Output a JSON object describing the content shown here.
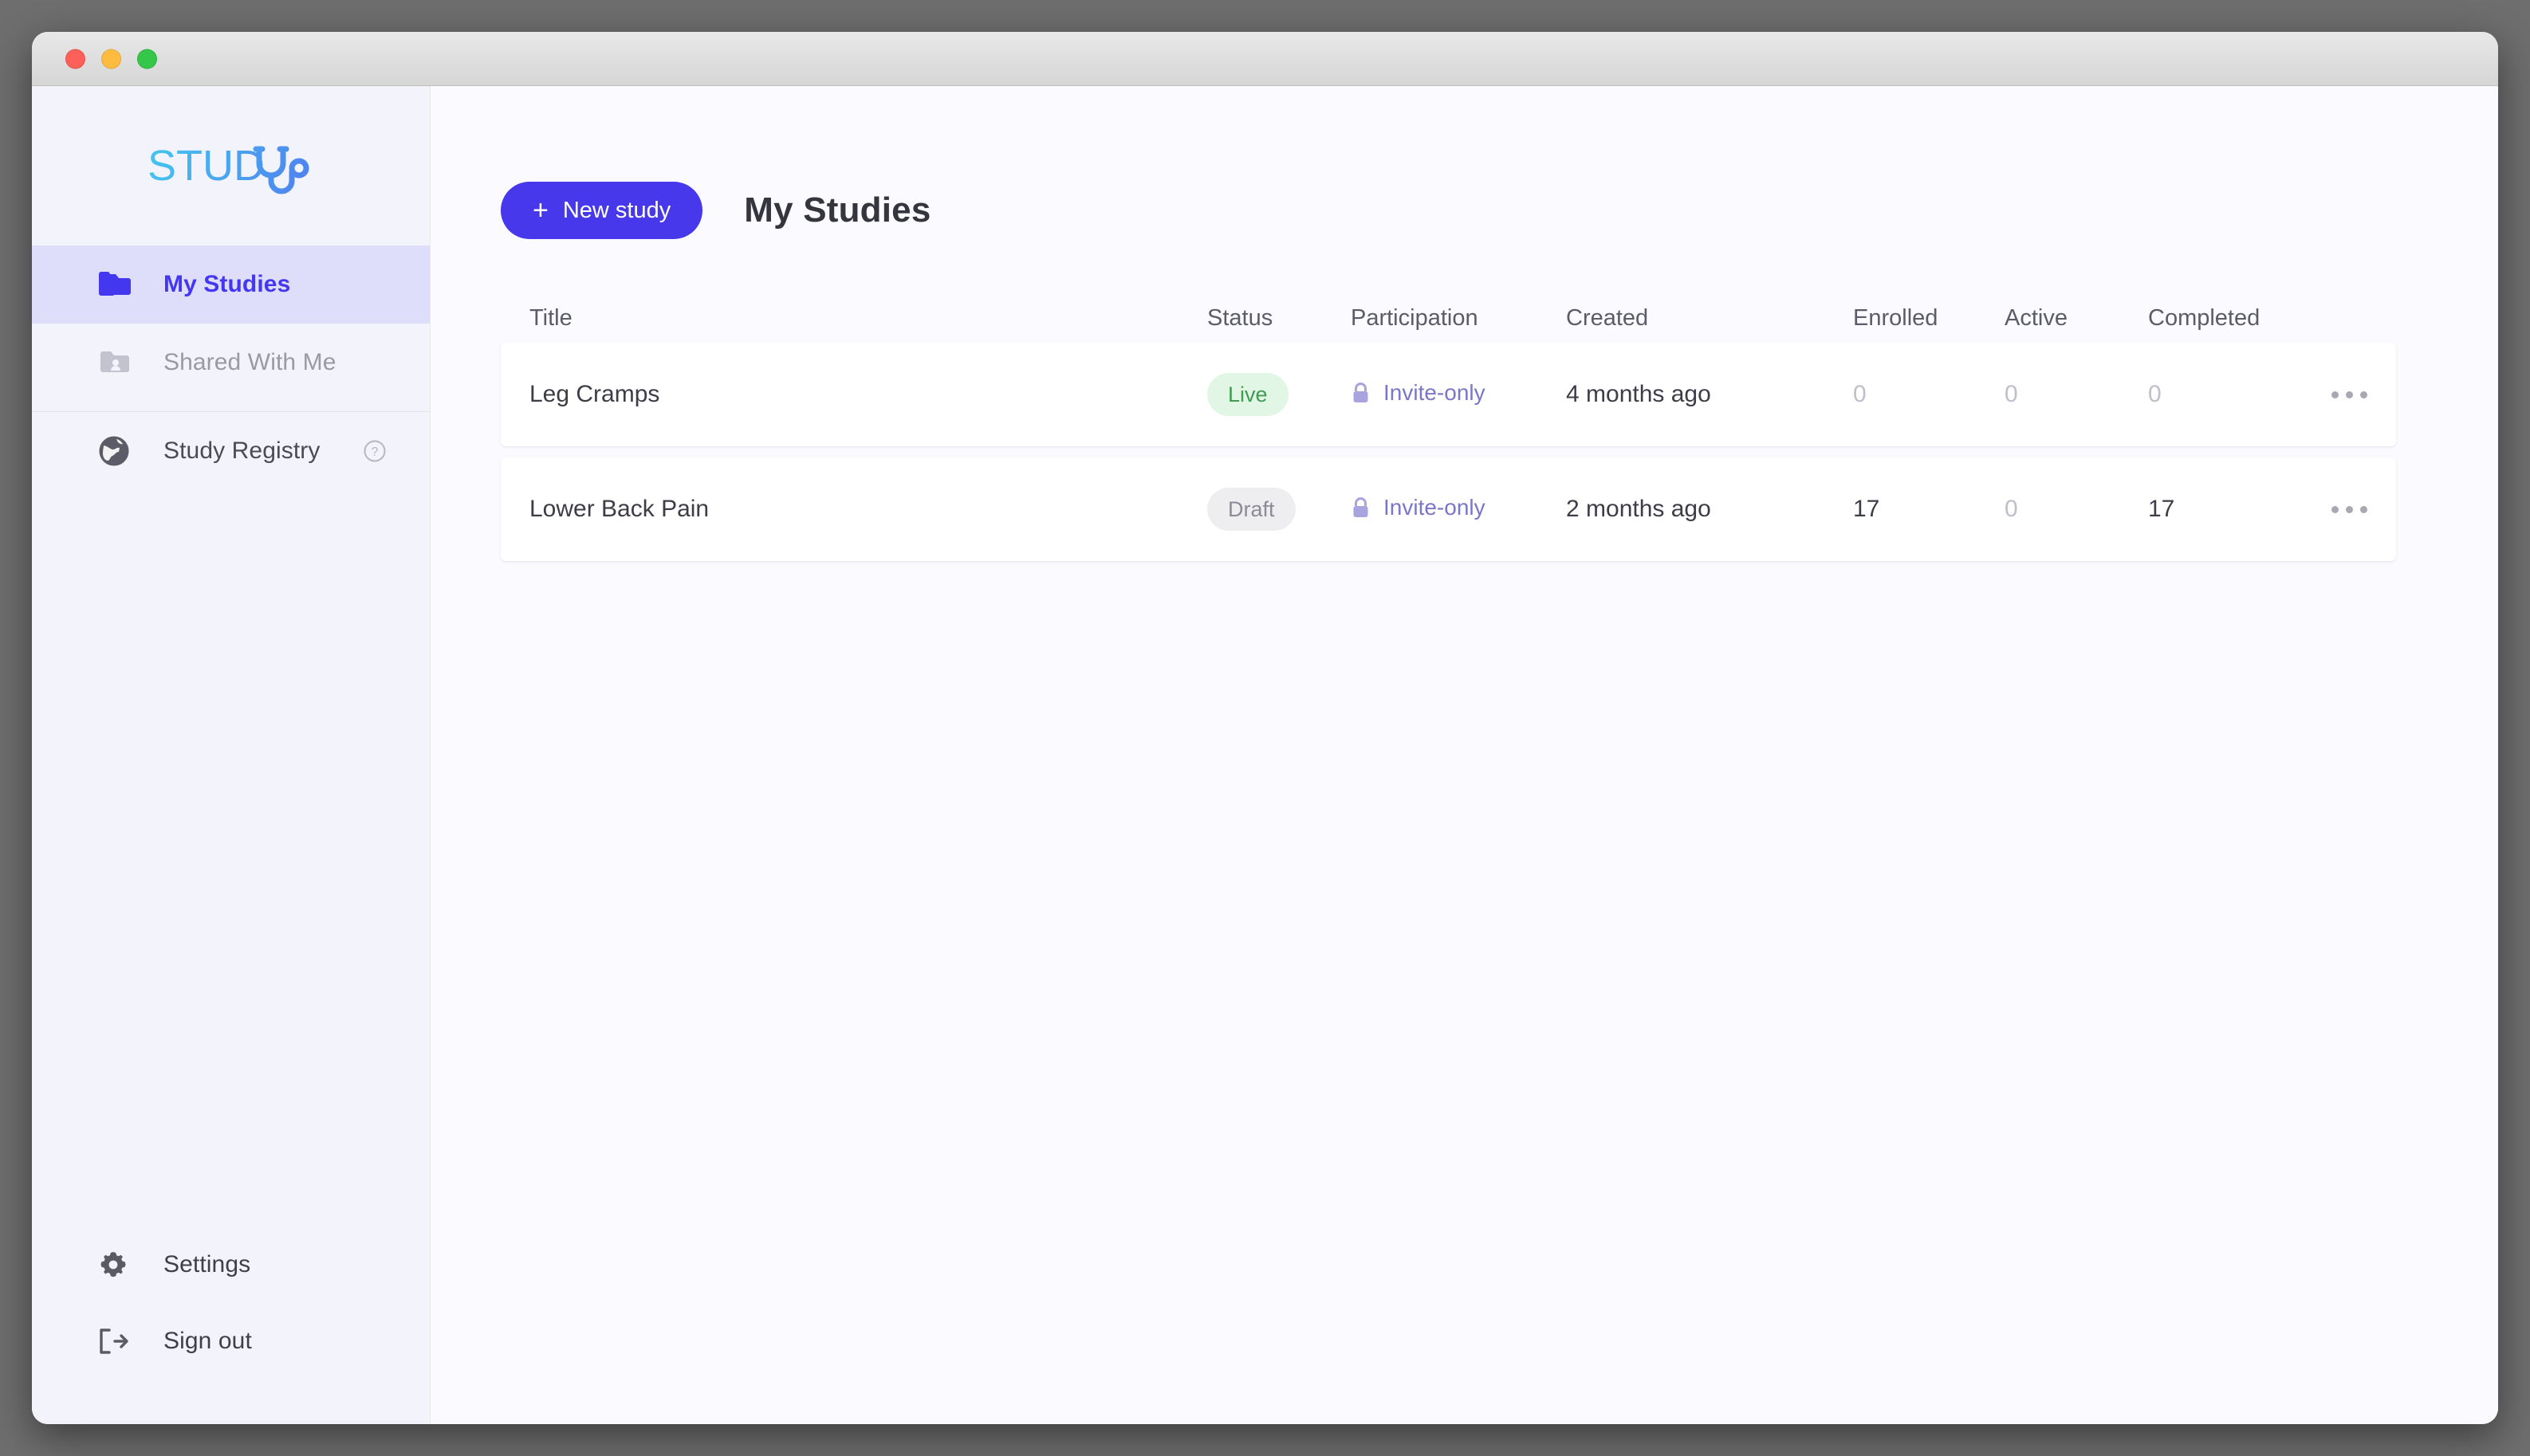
{
  "window": {
    "traffic_lights": [
      "close",
      "minimize",
      "zoom"
    ],
    "colors": {
      "accent": "#4739eb",
      "sidebar_bg": "#f3f3fc",
      "main_bg": "#fafaff",
      "live": "#3f9c52",
      "draft": "#8b8b96",
      "participation": "#7b76c9"
    }
  },
  "sidebar": {
    "logo_text": "STUDY",
    "logo_icon": "stethoscope-icon",
    "primary_items": [
      {
        "label": "My Studies",
        "icon": "folder-copy-icon",
        "active": true
      },
      {
        "label": "Shared With Me",
        "icon": "folder-shared-icon",
        "active": false
      }
    ],
    "secondary_items": [
      {
        "label": "Study Registry",
        "icon": "globe-icon",
        "help_icon": "help-circle-icon"
      }
    ],
    "bottom_items": [
      {
        "label": "Settings",
        "icon": "gear-icon"
      },
      {
        "label": "Sign out",
        "icon": "logout-icon"
      }
    ]
  },
  "toolbar": {
    "new_study_label": "New study",
    "new_study_plus": "+",
    "page_title": "My Studies"
  },
  "table": {
    "columns": [
      "Title",
      "Status",
      "Participation",
      "Created",
      "Enrolled",
      "Active",
      "Completed"
    ],
    "rows": [
      {
        "title": "Leg Cramps",
        "status": "Live",
        "status_kind": "live",
        "participation": "Invite-only",
        "participation_icon": "lock-icon",
        "created": "4 months ago",
        "enrolled": "0",
        "enrolled_zero": true,
        "active": "0",
        "active_zero": true,
        "completed": "0",
        "completed_zero": true,
        "menu_icon": "kebab-menu-icon"
      },
      {
        "title": "Lower Back Pain",
        "status": "Draft",
        "status_kind": "draft",
        "participation": "Invite-only",
        "participation_icon": "lock-icon",
        "created": "2 months ago",
        "enrolled": "17",
        "enrolled_zero": false,
        "active": "0",
        "active_zero": true,
        "completed": "17",
        "completed_zero": false,
        "menu_icon": "kebab-menu-icon"
      }
    ]
  }
}
